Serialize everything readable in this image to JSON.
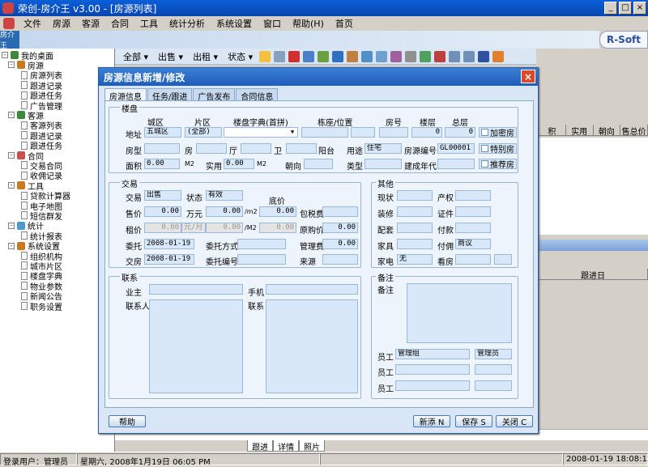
{
  "window": {
    "title": "荣创-房介王 v3.00 - [房源列表]"
  },
  "menu": [
    "文件",
    "房源",
    "客源",
    "合同",
    "工具",
    "统计分析",
    "系统设置",
    "窗口",
    "帮助(H)",
    "首页"
  ],
  "logo": "R-Soft",
  "sidebar_tab": "房介王",
  "toolbar": {
    "all": "全部",
    "sale": "出售",
    "rent": "出租",
    "status": "状态"
  },
  "tree": [
    {
      "label": "我的桌面",
      "level": 0,
      "type": "root"
    },
    {
      "label": "房源",
      "level": 1,
      "type": "folder"
    },
    {
      "label": "房源列表",
      "level": 2,
      "type": "doc"
    },
    {
      "label": "跟进记录",
      "level": 2,
      "type": "doc"
    },
    {
      "label": "跟进任务",
      "level": 2,
      "type": "doc"
    },
    {
      "label": "广告管理",
      "level": 2,
      "type": "doc"
    },
    {
      "label": "客源",
      "level": 1,
      "type": "folder"
    },
    {
      "label": "客源列表",
      "level": 2,
      "type": "doc"
    },
    {
      "label": "跟进记录",
      "level": 2,
      "type": "doc"
    },
    {
      "label": "跟进任务",
      "level": 2,
      "type": "doc"
    },
    {
      "label": "合同",
      "level": 1,
      "type": "folder"
    },
    {
      "label": "交易合同",
      "level": 2,
      "type": "doc"
    },
    {
      "label": "收佣记录",
      "level": 2,
      "type": "doc"
    },
    {
      "label": "工具",
      "level": 1,
      "type": "folder"
    },
    {
      "label": "贷款计算器",
      "level": 2,
      "type": "doc"
    },
    {
      "label": "电子地图",
      "level": 2,
      "type": "doc"
    },
    {
      "label": "短信群发",
      "level": 2,
      "type": "doc"
    },
    {
      "label": "统计",
      "level": 1,
      "type": "folder"
    },
    {
      "label": "统计报表",
      "level": 2,
      "type": "doc"
    },
    {
      "label": "系统设置",
      "level": 1,
      "type": "folder"
    },
    {
      "label": "组织机构",
      "level": 2,
      "type": "doc"
    },
    {
      "label": "城市片区",
      "level": 2,
      "type": "doc"
    },
    {
      "label": "楼盘字典",
      "level": 2,
      "type": "doc"
    },
    {
      "label": "物业参数",
      "level": 2,
      "type": "doc"
    },
    {
      "label": "新闻公告",
      "level": 2,
      "type": "doc"
    },
    {
      "label": "职务设置",
      "level": 2,
      "type": "doc"
    }
  ],
  "bg_columns": [
    "积",
    "实用",
    "朝向",
    "售总价"
  ],
  "bg_columns2": [
    "跟进日"
  ],
  "bg_tabs": [
    "跟进",
    "详情",
    "照片"
  ],
  "dialog": {
    "title": "房源信息新增/修改",
    "tabs": [
      "房源信息",
      "任务/跟进",
      "广告发布",
      "合同信息"
    ],
    "close": "×",
    "groups": {
      "loupan": "楼盘",
      "trade": "交易",
      "other": "其他",
      "contact": "联系",
      "note": "备注"
    },
    "loupan": {
      "h_district": "城区",
      "h_area": "片区",
      "h_dict": "楼盘字典(首拼)",
      "h_building": "栋座/位置",
      "h_room": "房号",
      "h_floor": "楼层",
      "h_total_floor": "总层",
      "addr_label": "地址",
      "district": "五城区",
      "area": "(全部)",
      "dict": "",
      "floor": "0",
      "total_floor": "0",
      "cb_encrypt": "加密房",
      "type_label": "房型",
      "room_unit": "房",
      "hall_unit": "厅",
      "bath_unit": "卫",
      "balcony_unit": "阳台",
      "usage_label": "用途",
      "usage": "住宅",
      "code_label": "房源编号",
      "code": "GL00001",
      "cb_special": "特别房",
      "area_label": "面积",
      "area_value": "0.00",
      "m2": "M2",
      "usable_label": "实用",
      "usable_value": "0.00",
      "m2b": "M2",
      "orient_label": "朝向",
      "kind_label": "类型",
      "year_label": "建成年代",
      "cb_recommend": "推荐房"
    },
    "trade": {
      "type_label": "交易",
      "type": "出售",
      "status_label": "状态",
      "status": "有效",
      "floor_price_label": "底价",
      "sale_label": "售价",
      "sale": "0.00",
      "wan": "万元",
      "unit_price": "0.00",
      "per_m2": "/m2",
      "floor_price": "0.00",
      "tax_label": "包税费",
      "rent_label": "租价",
      "rent": "0.00",
      "rent_unit": "元/月",
      "rent_unit_price": "0.00",
      "per_m2b": "/M2",
      "rent_floor": "0.00",
      "orig_label": "原购价",
      "orig": "0.00",
      "entrust_label": "委托",
      "entrust_date": "2008-01-19",
      "method_label": "委托方式",
      "fee_label": "管理费",
      "fee": "0.00",
      "deliver_label": "交房",
      "deliver_date": "2008-01-19",
      "entrust_no_label": "委托编号",
      "source_label": "来源"
    },
    "other": {
      "status_label": "现状",
      "right_label": "产权",
      "decor_label": "装修",
      "cert_label": "证件",
      "facility_label": "配套",
      "pay_label": "付款",
      "furniture_label": "家具",
      "commission_label": "付佣",
      "commission": "商议",
      "appliance_label": "家电",
      "appliance": "无",
      "view_label": "看房"
    },
    "contact": {
      "owner_label": "业主",
      "phone_label": "手机",
      "person_label": "联系人",
      "contact_label": "联系"
    },
    "note": {
      "label": "备注",
      "staff_label": "员工",
      "staff1": "管理组",
      "staff1_role": "管理员",
      "staff2_label": "员工",
      "staff3_label": "员工"
    },
    "buttons": {
      "help": "帮助",
      "new": "新添 N",
      "save": "保存 S",
      "close": "关闭 C"
    }
  },
  "status": {
    "user": "登录用户：管理员",
    "date": "星期六, 2008年1月19日 06:05 PM",
    "datetime": "2008-01-19 18:08:12"
  }
}
